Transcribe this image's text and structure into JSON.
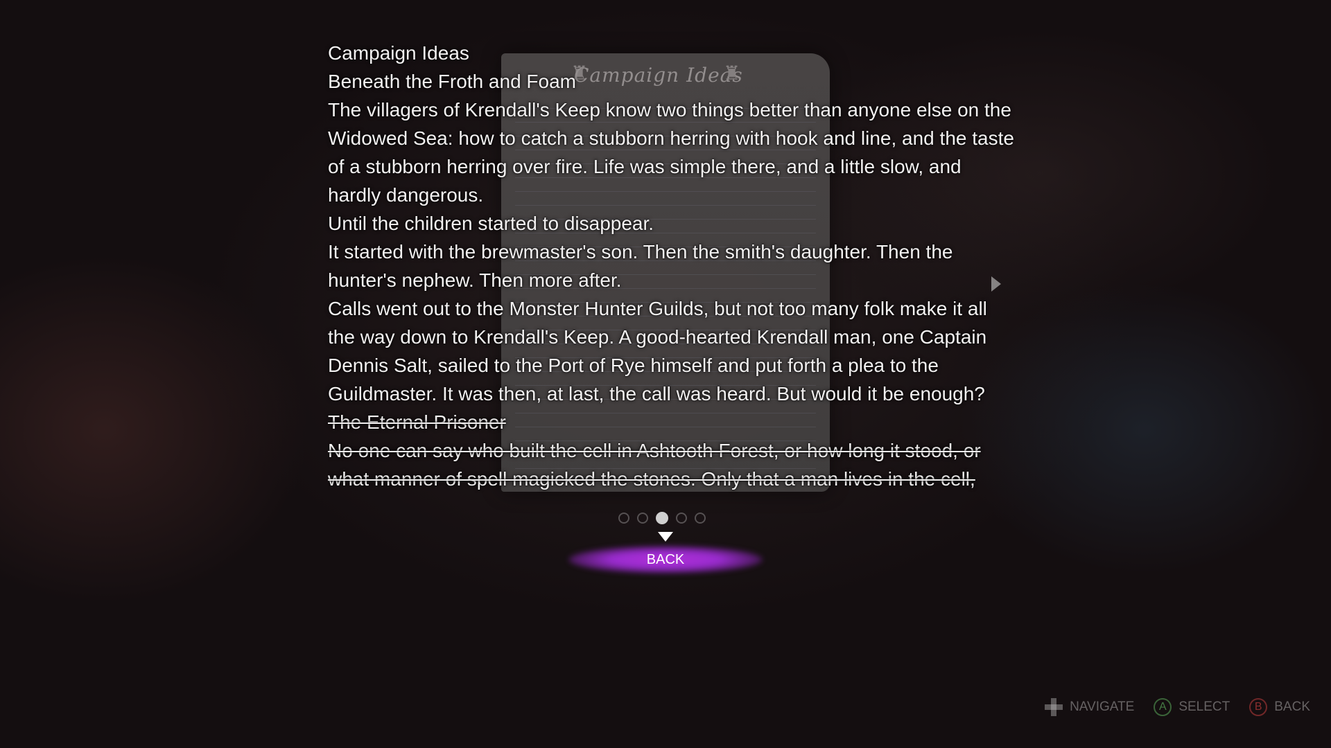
{
  "note": {
    "paper_title": "Campaign Ideas"
  },
  "content": {
    "title": "Campaign Ideas",
    "section1_title": "Beneath the Froth and Foam",
    "para1": "The villagers of Krendall's Keep know two things better than anyone else on the Widowed Sea: how to catch a stubborn herring with hook and line, and the taste of a stubborn herring over fire. Life was simple there, and a little slow, and hardly dangerous.",
    "para2": "Until the children started to disappear.",
    "para3": "It started with the brewmaster's son. Then the smith's daughter. Then the hunter's nephew. Then more after.",
    "para4": "Calls went out to the Monster Hunter Guilds, but not too many folk make it all the way down to Krendall's Keep. A good-hearted Krendall man, one Captain Dennis Salt, sailed to the Port of Rye himself and put forth a plea to the Guildmaster. It was then, at last, the call was heard. But would it be enough?",
    "section2_title": "The Eternal Prisoner",
    "para5": "No one can say who built the cell in Ashtooth Forest, or how long it stood, or what manner of spell magicked the stones. Only that a man lives in the cell, alone and"
  },
  "pager": {
    "total": 5,
    "active_index": 2
  },
  "back_button": {
    "label": "BACK"
  },
  "hints": {
    "navigate": "NAVIGATE",
    "select": "SELECT",
    "back": "BACK",
    "a_glyph": "A",
    "b_glyph": "B"
  }
}
